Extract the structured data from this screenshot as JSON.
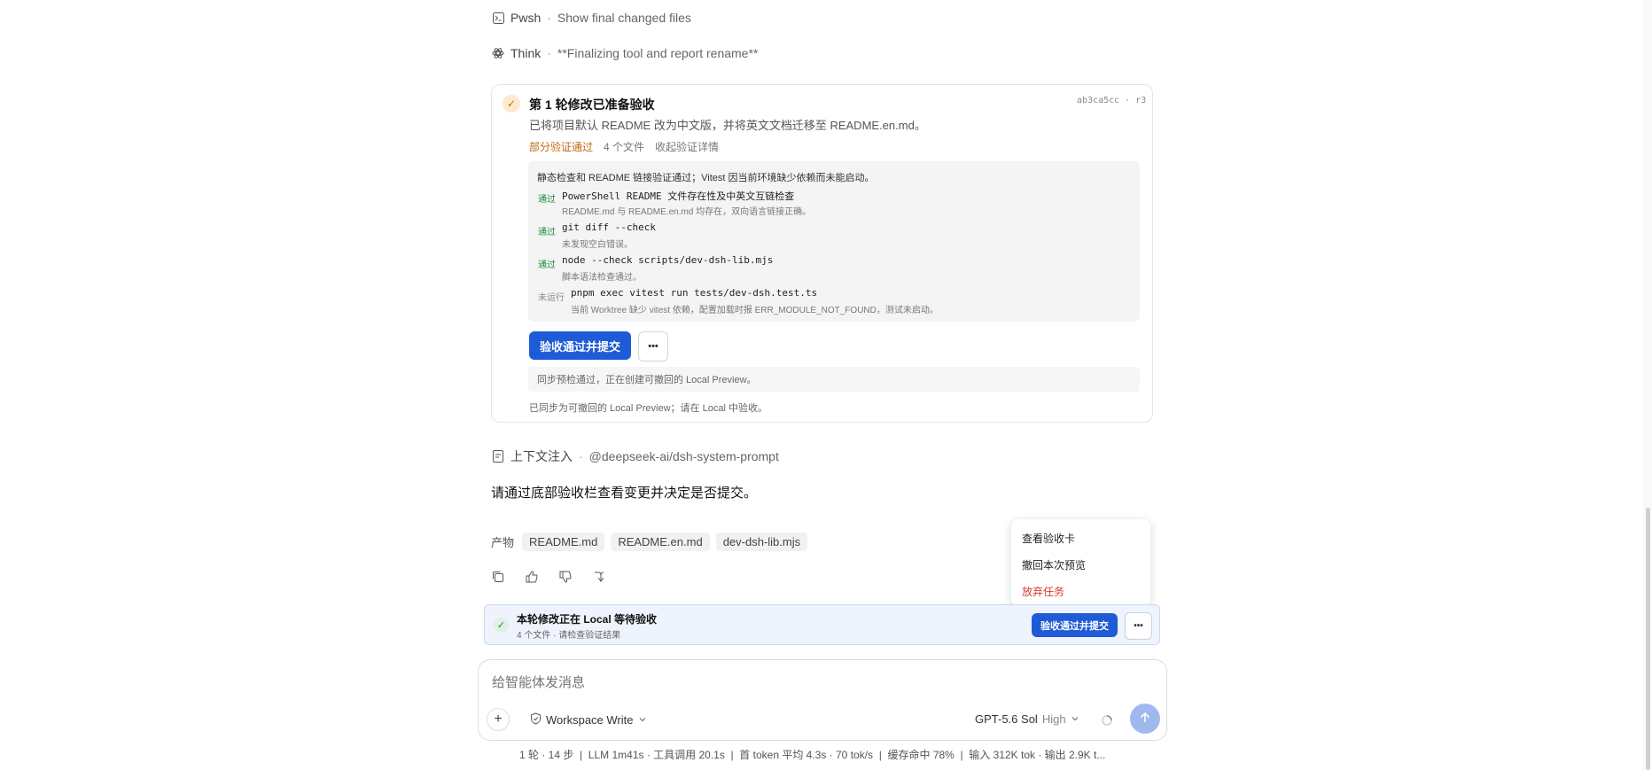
{
  "activity": [
    {
      "tool": "Pwsh",
      "description": "Show final changed files",
      "icon": "terminal-icon"
    },
    {
      "tool": "Think",
      "description": "**Finalizing tool and report rename**",
      "icon": "brain-icon"
    }
  ],
  "card": {
    "title": "第 1 轮修改已准备验收",
    "hash": "ab3ca5cc · r3",
    "summary": "已将项目默认 README 改为中文版，并将英文文档迁移至 README.en.md。",
    "meta": {
      "status": "部分验证通过",
      "files": "4 个文件",
      "toggle": "收起验证详情"
    },
    "checks_summary": "静态检查和 README 链接验证通过；Vitest 因当前环境缺少依赖而未能启动。",
    "checks": [
      {
        "status": "通过",
        "command": "PowerShell README 文件存在性及中英文互链检查",
        "note": "README.md 与 README.en.md 均存在，双向语言链接正确。"
      },
      {
        "status": "通过",
        "command": "git diff --check",
        "note": "未发现空白错误。"
      },
      {
        "status": "通过",
        "command": "node --check scripts/dev-dsh-lib.mjs",
        "note": "脚本语法检查通过。"
      },
      {
        "status": "未运行",
        "command": "pnpm exec vitest run tests/dev-dsh.test.ts",
        "note": "当前 Worktree 缺少 vitest 依赖，配置加载时报 ERR_MODULE_NOT_FOUND，测试未启动。"
      }
    ],
    "primary_button": "验收通过并提交",
    "more_button": "•••",
    "sync_status": "同步预检通过，正在创建可撤回的 Local Preview。",
    "final_status": "已同步为可撤回的 Local Preview；请在 Local 中验收。"
  },
  "context": {
    "label": "上下文注入",
    "value": "@deepseek-ai/dsh-system-prompt"
  },
  "message": "请通过底部验收栏查看变更并决定是否提交。",
  "artifacts": {
    "label": "产物",
    "files": [
      "README.md",
      "README.en.md",
      "dev-dsh-lib.mjs"
    ]
  },
  "actions": [
    "copy-icon",
    "thumbs-up-icon",
    "thumbs-down-icon",
    "branch-icon"
  ],
  "menu": {
    "items": [
      "查看验收卡",
      "撤回本次预览",
      "放弃任务"
    ]
  },
  "bar": {
    "title": "本轮修改正在 Local 等待验收",
    "subtitle": "4 个文件 · 请检查验证结果",
    "button": "验收通过并提交",
    "more": "•••"
  },
  "composer": {
    "placeholder": "给智能体发消息",
    "mode": "Workspace Write",
    "model": "GPT-5.6 Sol",
    "effort": "High"
  },
  "footer": "1 轮 · 14 步  |  LLM 1m41s · 工具调用 20.1s  |  首 token 平均 4.3s · 70 tok/s  |  缓存命中 78%  |  输入 312K tok · 输出 2.9K t...",
  "colors": {
    "accent": "#1f5bd6",
    "warn": "#c06a12",
    "pass": "#1d8a3a",
    "danger": "#d63a2a"
  }
}
